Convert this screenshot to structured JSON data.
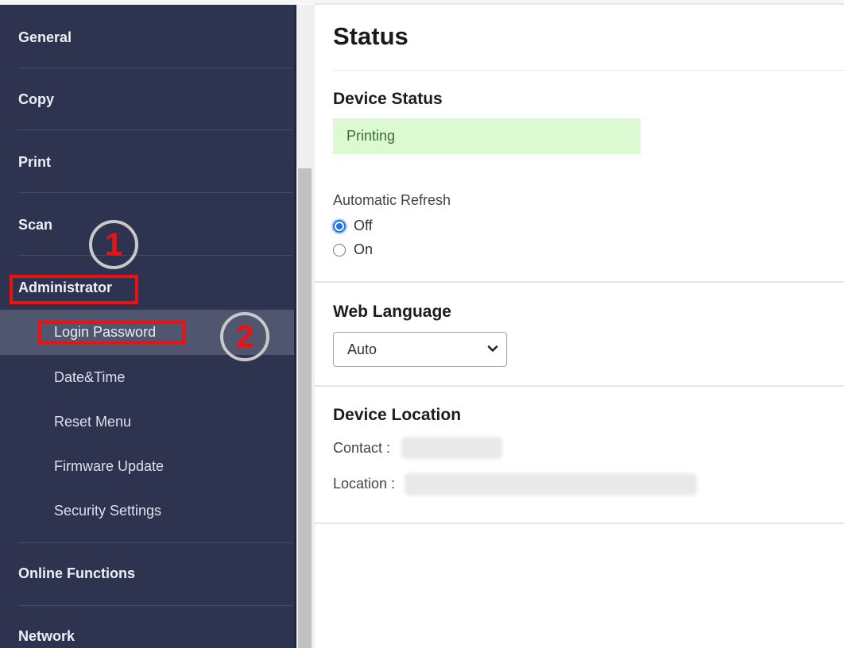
{
  "sidebar": {
    "groups": [
      {
        "label": "General"
      },
      {
        "label": "Copy"
      },
      {
        "label": "Print"
      },
      {
        "label": "Scan"
      },
      {
        "label": "Administrator"
      },
      {
        "label": "Online Functions"
      },
      {
        "label": "Network"
      }
    ],
    "admin_items": [
      {
        "label": "Login Password",
        "selected": true
      },
      {
        "label": "Date&Time"
      },
      {
        "label": "Reset Menu"
      },
      {
        "label": "Firmware Update"
      },
      {
        "label": "Security Settings"
      }
    ]
  },
  "main": {
    "title": "Status",
    "device_status": {
      "heading": "Device Status",
      "value": "Printing",
      "color": "#dcfad2"
    },
    "auto_refresh": {
      "label": "Automatic Refresh",
      "options": [
        {
          "label": "Off",
          "checked": true
        },
        {
          "label": "On",
          "checked": false
        }
      ]
    },
    "web_language": {
      "heading": "Web Language",
      "selected": "Auto"
    },
    "device_location": {
      "heading": "Device Location",
      "contact_label": "Contact :",
      "location_label": "Location :"
    }
  },
  "annotations": {
    "step1": "1",
    "step2": "2",
    "highlight_color": "#ee1111"
  }
}
